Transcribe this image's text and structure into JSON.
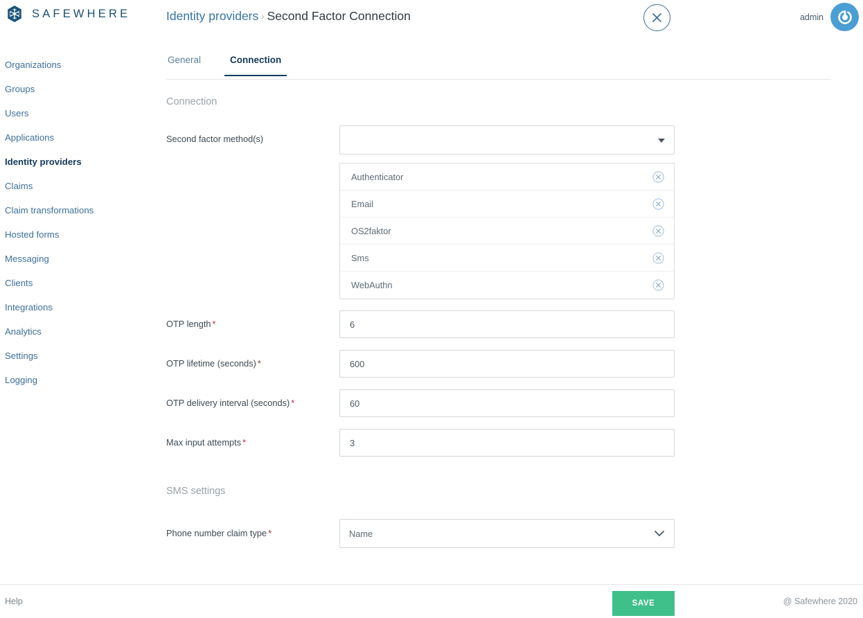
{
  "header": {
    "brand_name": "SAFEWHERE",
    "brand_logo_icon": "safewhere-snowflake-hexagon-logo",
    "breadcrumb": {
      "parent": "Identity providers",
      "separator": "›",
      "current": "Second Factor Connection"
    },
    "close_icon": "close-x-circle-icon",
    "user_name": "admin",
    "avatar_icon": "power-spiral-avatar-icon"
  },
  "sidebar": {
    "items": [
      {
        "label": "Organizations",
        "active": false
      },
      {
        "label": "Groups",
        "active": false
      },
      {
        "label": "Users",
        "active": false
      },
      {
        "label": "Applications",
        "active": false
      },
      {
        "label": "Identity providers",
        "active": true
      },
      {
        "label": "Claims",
        "active": false
      },
      {
        "label": "Claim transformations",
        "active": false
      },
      {
        "label": "Hosted forms",
        "active": false
      },
      {
        "label": "Messaging",
        "active": false
      },
      {
        "label": "Clients",
        "active": false
      },
      {
        "label": "Integrations",
        "active": false
      },
      {
        "label": "Analytics",
        "active": false
      },
      {
        "label": "Settings",
        "active": false
      },
      {
        "label": "Logging",
        "active": false
      }
    ]
  },
  "main": {
    "tabs": [
      {
        "label": "General",
        "active": false
      },
      {
        "label": "Connection",
        "active": true
      }
    ],
    "connection_section": {
      "title": "Connection",
      "second_factor": {
        "label": "Second factor method(s)",
        "required": false,
        "value": "",
        "placeholder": "",
        "caret_icon": "chevron-down-icon",
        "selected_items": [
          {
            "label": "Authenticator",
            "remove_icon": "remove-x-circle-icon"
          },
          {
            "label": "Email",
            "remove_icon": "remove-x-circle-icon"
          },
          {
            "label": "OS2faktor",
            "remove_icon": "remove-x-circle-icon"
          },
          {
            "label": "Sms",
            "remove_icon": "remove-x-circle-icon"
          },
          {
            "label": "WebAuthn",
            "remove_icon": "remove-x-circle-icon"
          }
        ]
      },
      "otp_length": {
        "label": "OTP length",
        "required_marker": "*",
        "value": "6"
      },
      "otp_lifetime": {
        "label": "OTP lifetime (seconds)",
        "required_marker": "*",
        "value": "600"
      },
      "otp_delivery_interval": {
        "label": "OTP delivery interval (seconds)",
        "required_marker": "*",
        "value": "60"
      },
      "max_input_attempts": {
        "label": "Max input attempts",
        "required_marker": "*",
        "value": "3"
      }
    },
    "sms_section": {
      "title": "SMS settings",
      "phone_claim_type": {
        "label": "Phone number claim type",
        "required_marker": "*",
        "value": "Name",
        "options": [
          "Name"
        ],
        "chevron_icon": "chevron-down-icon"
      }
    },
    "next_section_clipped": ""
  },
  "footer": {
    "help_label": "Help",
    "save_label": "SAVE",
    "copyright": "@ Safewhere 2020"
  },
  "colors": {
    "brand_blue": "#1b4f72",
    "link_blue": "#3573a5",
    "active_navy": "#14395c",
    "save_green": "#3fc08a",
    "required_red": "#b32b3a",
    "avatar_blue": "#4a9ed4",
    "muted_gray": "#9aa3aa"
  }
}
